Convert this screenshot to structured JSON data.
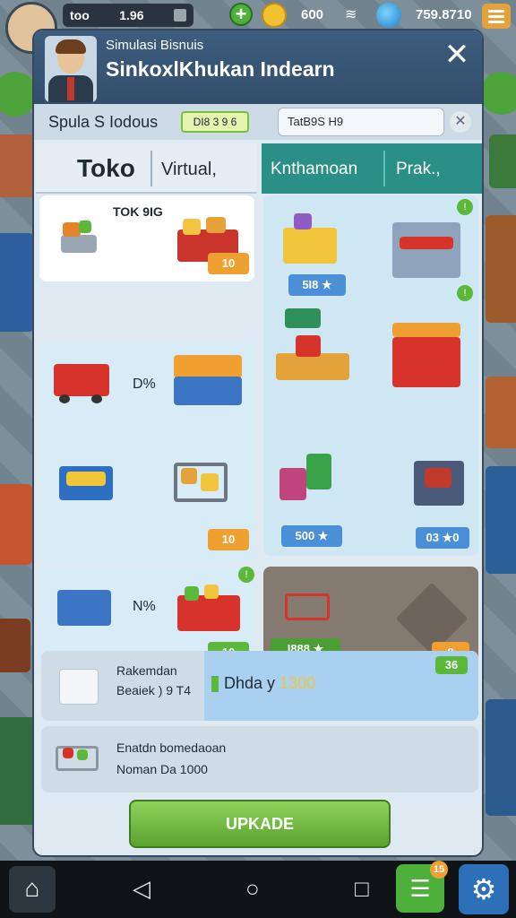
{
  "hud": {
    "left_value": "too",
    "left_value2": "1.96",
    "coins": "600",
    "cash": "759.8710"
  },
  "modal": {
    "subtitle": "Simulasi Bisnuis",
    "title": "SinkoxlKhukan Indearn",
    "close": "✕"
  },
  "search": {
    "label": "Spula S Iodous",
    "badge": "DI8 3 9 6",
    "input_value": "TatB9S H9",
    "clear": "✕"
  },
  "tabs_left": {
    "tab1": "Toko",
    "tab2": "Virtual,"
  },
  "tabs_right": {
    "tab1": "Knthamoan",
    "tab2": "Prak.,"
  },
  "left_cards": [
    {
      "label": "TOK 9IG",
      "price": "10"
    },
    {
      "label": "D%",
      "price": "10"
    },
    {
      "label": "N%",
      "price": "10"
    }
  ],
  "right_cards": [
    {
      "price": "5I8 ★"
    },
    {
      "price": "500 ★",
      "price2": "03 ★0"
    },
    {
      "price": "I888 ★",
      "price2": "8"
    }
  ],
  "summary1": {
    "line1": "Rakemdan",
    "line2": "Beaiek ) 9 T4",
    "highlight": "Dhda y ",
    "highlight_value": "1300",
    "badge": "36"
  },
  "summary2": {
    "line1": "Enatdn bomedaoan",
    "line2": "Noman Da 1000"
  },
  "upgrade": {
    "label": "UPKADE"
  },
  "nav": {
    "badge": "15"
  }
}
